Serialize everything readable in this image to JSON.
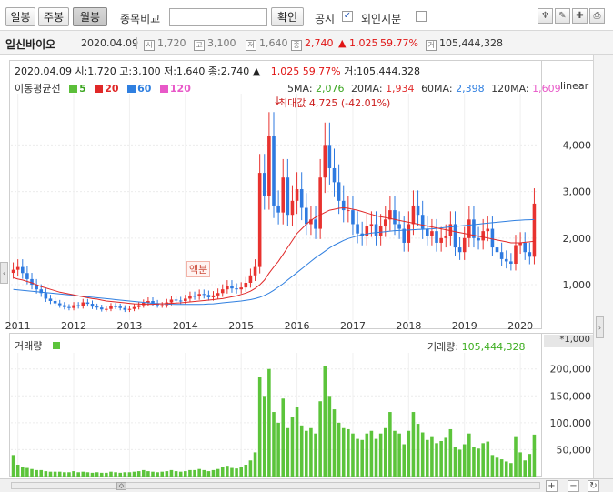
{
  "toolbar": {
    "periods": [
      "일봉",
      "주봉",
      "월봉"
    ],
    "active_period": "월봉",
    "compare_label": "종목비교",
    "compare_value": "",
    "confirm_label": "확인",
    "disclosure_label": "공시",
    "disclosure_checked": true,
    "foreign_label": "외인지분",
    "foreign_checked": false
  },
  "stock": {
    "name": "일신바이오",
    "date": "2020.04.09",
    "open": "1,720",
    "high": "3,100",
    "low": "1,640",
    "close": "2,740",
    "change": "▲ 1,025",
    "change_pct": "59.77%",
    "volume": "105,444,328"
  },
  "chart": {
    "header_date": "2020.04.09",
    "header_ohlc": "시:1,720 고:3,100 저:1,640 종:2,740 ▲",
    "header_change": "1,025 59.77%",
    "header_volume": "거:105,444,328",
    "ma_title": "이동평균선",
    "ma_legend": [
      {
        "label": "5",
        "color": "#5cbf3a"
      },
      {
        "label": "20",
        "color": "#e02828"
      },
      {
        "label": "60",
        "color": "#2f7fe0"
      },
      {
        "label": "120",
        "color": "#e858c8"
      }
    ],
    "ma_values": [
      {
        "label": "5MA:",
        "value": "2,076",
        "color": "#3aa51f"
      },
      {
        "label": "20MA:",
        "value": "1,934",
        "color": "#e02828"
      },
      {
        "label": "60MA:",
        "value": "2,398",
        "color": "#2f7fe0"
      },
      {
        "label": "120MA:",
        "value": "1,609",
        "color": "#e858c8"
      }
    ],
    "scale_label": "linear",
    "max_label": "최대값 4,725 (-42.01%)",
    "face_value_label": "액분",
    "volume_title": "거래량",
    "volume_value_label": "거래량:",
    "volume_value": "105,444,328",
    "volume_unit": "*1,000"
  },
  "chart_data": {
    "type": "bar",
    "title": "",
    "price_axis": {
      "ticks": [
        1000,
        2000,
        3000,
        4000
      ],
      "tick_labels": [
        "1,000",
        "2,000",
        "3,000",
        "4,000"
      ],
      "range": [
        240,
        5100
      ]
    },
    "volume_axis": {
      "ticks": [
        50000,
        100000,
        150000,
        200000
      ],
      "tick_labels": [
        "50,000",
        "100,000",
        "150,000",
        "200,000"
      ],
      "range": [
        0,
        230000
      ]
    },
    "x_labels": [
      "2011",
      "2012",
      "2013",
      "2014",
      "2015",
      "2016",
      "2017",
      "2018",
      "2019",
      "2020"
    ],
    "categories": [
      "2010-12",
      "2011-01",
      "2011-02",
      "2011-03",
      "2011-04",
      "2011-05",
      "2011-06",
      "2011-07",
      "2011-08",
      "2011-09",
      "2011-10",
      "2011-11",
      "2011-12",
      "2012-01",
      "2012-02",
      "2012-03",
      "2012-04",
      "2012-05",
      "2012-06",
      "2012-07",
      "2012-08",
      "2012-09",
      "2012-10",
      "2012-11",
      "2012-12",
      "2013-01",
      "2013-02",
      "2013-03",
      "2013-04",
      "2013-05",
      "2013-06",
      "2013-07",
      "2013-08",
      "2013-09",
      "2013-10",
      "2013-11",
      "2013-12",
      "2014-01",
      "2014-02",
      "2014-03",
      "2014-04",
      "2014-05",
      "2014-06",
      "2014-07",
      "2014-08",
      "2014-09",
      "2014-10",
      "2014-11",
      "2014-12",
      "2015-01",
      "2015-02",
      "2015-03",
      "2015-04",
      "2015-05",
      "2015-06",
      "2015-07",
      "2015-08",
      "2015-09",
      "2015-10",
      "2015-11",
      "2015-12",
      "2016-01",
      "2016-02",
      "2016-03",
      "2016-04",
      "2016-05",
      "2016-06",
      "2016-07",
      "2016-08",
      "2016-09",
      "2016-10",
      "2016-11",
      "2016-12",
      "2017-01",
      "2017-02",
      "2017-03",
      "2017-04",
      "2017-05",
      "2017-06",
      "2017-07",
      "2017-08",
      "2017-09",
      "2017-10",
      "2017-11",
      "2017-12",
      "2018-01",
      "2018-02",
      "2018-03",
      "2018-04",
      "2018-05",
      "2018-06",
      "2018-07",
      "2018-08",
      "2018-09",
      "2018-10",
      "2018-11",
      "2018-12",
      "2019-01",
      "2019-02",
      "2019-03",
      "2019-04",
      "2019-05",
      "2019-06",
      "2019-07",
      "2019-08",
      "2019-09",
      "2019-10",
      "2019-11",
      "2019-12",
      "2020-01",
      "2020-02",
      "2020-03",
      "2020-04"
    ],
    "close": [
      1320,
      1380,
      1250,
      1120,
      1000,
      900,
      820,
      700,
      650,
      600,
      560,
      520,
      500,
      560,
      540,
      620,
      590,
      530,
      510,
      470,
      480,
      540,
      530,
      500,
      460,
      480,
      520,
      560,
      610,
      650,
      600,
      560,
      560,
      620,
      680,
      660,
      650,
      700,
      760,
      750,
      800,
      780,
      730,
      770,
      820,
      900,
      980,
      920,
      900,
      940,
      1040,
      1200,
      1380,
      3400,
      2900,
      4200,
      2700,
      2550,
      3300,
      2500,
      2800,
      3050,
      2650,
      2300,
      2400,
      2200,
      3300,
      4000,
      3500,
      3200,
      2800,
      2600,
      2600,
      2300,
      2100,
      2050,
      2250,
      2300,
      2050,
      2250,
      2400,
      2600,
      2300,
      2200,
      1900,
      2300,
      2700,
      2500,
      2200,
      2050,
      2150,
      1900,
      2000,
      2050,
      2300,
      1800,
      1700,
      2000,
      2400,
      2000,
      1950,
      2150,
      2200,
      1800,
      1700,
      1550,
      1500,
      1450,
      1850,
      1900,
      1700,
      1600,
      2740
    ],
    "volume": [
      40,
      22,
      18,
      16,
      14,
      12,
      12,
      10,
      9,
      9,
      9,
      8,
      8,
      10,
      8,
      9,
      8,
      7,
      8,
      7,
      7,
      9,
      8,
      7,
      8,
      8,
      9,
      10,
      12,
      10,
      9,
      8,
      9,
      10,
      12,
      10,
      9,
      10,
      12,
      12,
      14,
      12,
      10,
      12,
      14,
      18,
      20,
      16,
      15,
      18,
      22,
      30,
      45,
      185,
      150,
      200,
      120,
      100,
      145,
      90,
      110,
      130,
      95,
      85,
      90,
      80,
      140,
      205,
      150,
      125,
      100,
      90,
      88,
      80,
      70,
      68,
      80,
      85,
      70,
      80,
      90,
      120,
      85,
      80,
      60,
      85,
      120,
      98,
      82,
      68,
      75,
      62,
      66,
      72,
      88,
      55,
      50,
      60,
      80,
      55,
      52,
      62,
      65,
      40,
      35,
      32,
      28,
      25,
      75,
      45,
      30,
      42,
      78
    ],
    "ma20": [
      1150,
      1120,
      1100,
      1070,
      1040,
      1000,
      960,
      930,
      900,
      870,
      840,
      820,
      800,
      780,
      760,
      740,
      720,
      700,
      690,
      670,
      650,
      640,
      630,
      620,
      610,
      600,
      590,
      585,
      580,
      580,
      580,
      585,
      590,
      595,
      600,
      605,
      610,
      620,
      630,
      640,
      650,
      660,
      670,
      680,
      690,
      700,
      720,
      740,
      760,
      790,
      820,
      860,
      920,
      1000,
      1100,
      1250,
      1380,
      1500,
      1650,
      1800,
      1950,
      2100,
      2200,
      2300,
      2380,
      2450,
      2500,
      2550,
      2600,
      2620,
      2640,
      2650,
      2640,
      2620,
      2600,
      2570,
      2540,
      2510,
      2480,
      2460,
      2440,
      2420,
      2400,
      2380,
      2360,
      2340,
      2320,
      2300,
      2280,
      2260,
      2240,
      2220,
      2200,
      2180,
      2160,
      2140,
      2120,
      2100,
      2080,
      2060,
      2040,
      2020,
      2000,
      1980,
      1960,
      1940,
      1920,
      1900,
      1900,
      1900,
      1910,
      1920,
      1934
    ],
    "ma60": [
      900,
      890,
      880,
      870,
      860,
      850,
      840,
      830,
      820,
      810,
      800,
      790,
      780,
      770,
      760,
      750,
      740,
      730,
      720,
      710,
      700,
      690,
      680,
      670,
      660,
      650,
      640,
      630,
      620,
      610,
      600,
      595,
      590,
      585,
      580,
      578,
      576,
      575,
      575,
      576,
      578,
      580,
      585,
      590,
      600,
      610,
      620,
      630,
      640,
      650,
      665,
      680,
      700,
      730,
      770,
      820,
      880,
      950,
      1020,
      1100,
      1180,
      1260,
      1340,
      1420,
      1500,
      1580,
      1650,
      1720,
      1790,
      1850,
      1900,
      1950,
      1990,
      2020,
      2050,
      2070,
      2090,
      2110,
      2120,
      2130,
      2140,
      2150,
      2160,
      2165,
      2170,
      2175,
      2180,
      2185,
      2190,
      2195,
      2200,
      2210,
      2220,
      2230,
      2240,
      2250,
      2260,
      2270,
      2280,
      2290,
      2300,
      2310,
      2320,
      2330,
      2340,
      2350,
      2360,
      2370,
      2380,
      2385,
      2390,
      2395,
      2398
    ]
  }
}
